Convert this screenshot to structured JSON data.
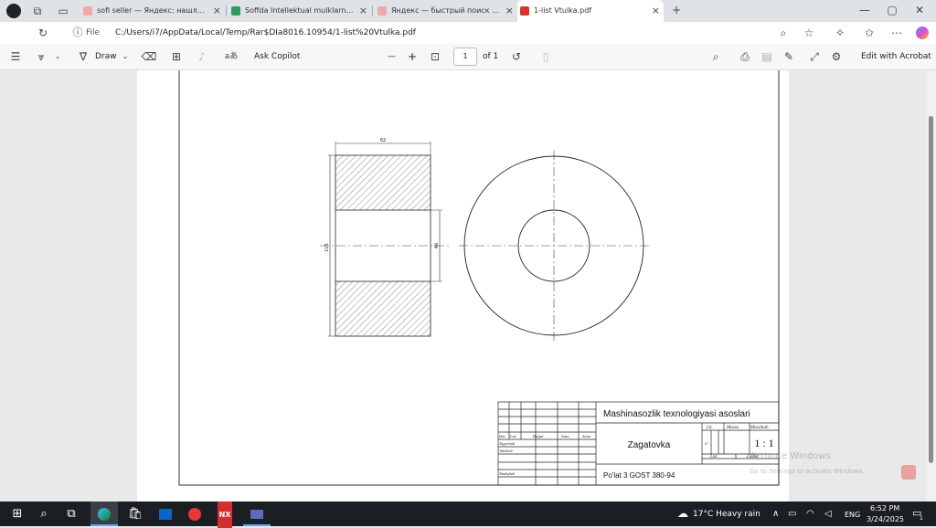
{
  "browser": {
    "tabs": [
      {
        "title": "sofi seller — Яндекс: нашлось 1..."
      },
      {
        "title": "Soffda Intellektual mulklarning..."
      },
      {
        "title": "Яндекс — быстрый поиск в инте..."
      },
      {
        "title": "1-list Vtulka.pdf"
      }
    ],
    "new_tab": "+",
    "address_prefix": "File",
    "address": "C:/Users/i7/AppData/Local/Temp/Rar$DIa8016.10954/1-list%20Vtulka.pdf"
  },
  "pdf_toolbar": {
    "draw_label": "Draw",
    "ask_copilot": "Ask Copilot",
    "zoom_out": "—",
    "zoom_in": "+",
    "current_page": "1",
    "page_of": "of 1",
    "edit_acrobat": "Edit with Acrobat"
  },
  "drawing": {
    "dim_top": "62",
    "dim_left": "115",
    "dim_right": "46",
    "title_block": {
      "org": "Mashinasozlik texnologiyasi asoslari",
      "name": "Zagatovka",
      "material": "Po'lat 3 GOST 380-94",
      "col_lit": "Lit.",
      "col_massa": "Massa",
      "col_masshtab": "Masshtab",
      "lit_value": "o'",
      "scale": "1 : 1",
      "list": "List",
      "listlar": "Listlar",
      "row_izm": "Izm.",
      "row_list": "List",
      "row_hujjat": "Hujjat",
      "row_imzo": "Imzo",
      "row_sana": "Sana",
      "tayyorladi": "Tayyorladi",
      "tekshirdi": "Tekshirdi",
      "tasdiqladi": "Tasdiqladi"
    }
  },
  "watermark": {
    "line1": "Activate Windows",
    "line2": "Go to Settings to activate Windows."
  },
  "taskbar": {
    "weather": "17°C  Heavy rain",
    "lang": "ENG",
    "time": "6:52 PM",
    "date": "3/24/2025",
    "notif_count": "1"
  },
  "colors": {
    "accent": "#0067c0",
    "taskbar": "#1b1f24"
  }
}
